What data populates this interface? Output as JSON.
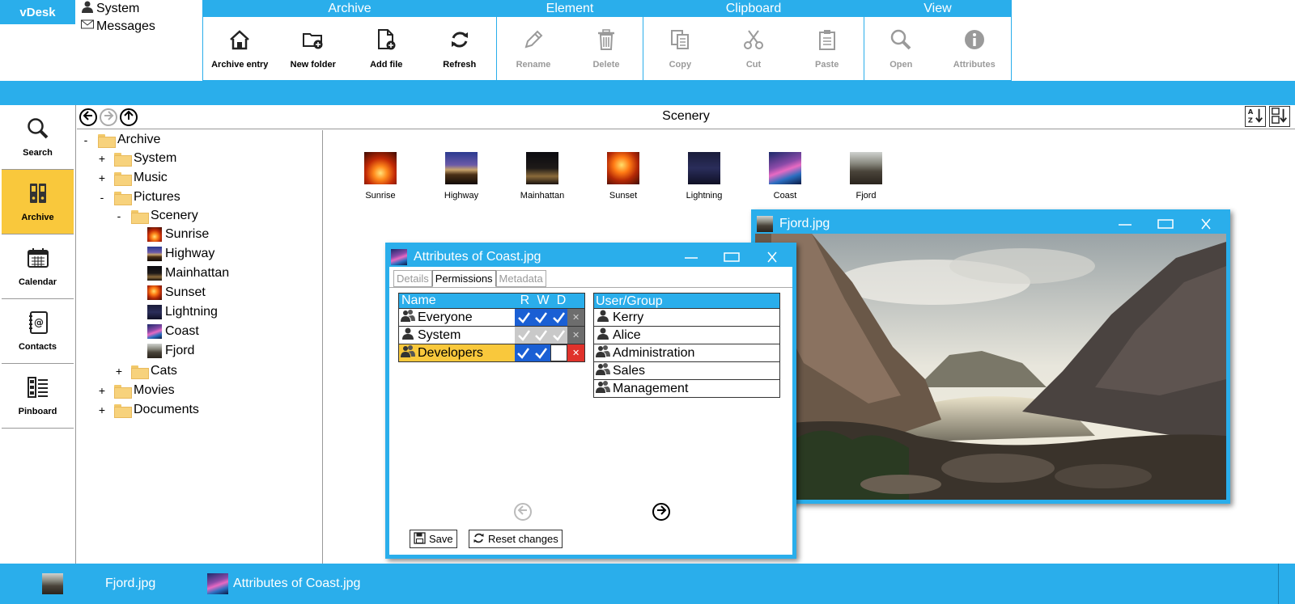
{
  "app": {
    "brand": "vDesk"
  },
  "user_menu": {
    "system": "System",
    "messages": "Messages"
  },
  "ribbon": {
    "archive": {
      "title": "Archive",
      "buttons": [
        "Archive entry",
        "New folder",
        "Add file",
        "Refresh"
      ]
    },
    "element": {
      "title": "Element",
      "buttons": [
        "Rename",
        "Delete"
      ]
    },
    "clipboard": {
      "title": "Clipboard",
      "buttons": [
        "Copy",
        "Cut",
        "Paste"
      ]
    },
    "view": {
      "title": "View",
      "buttons": [
        "Open",
        "Attributes"
      ]
    }
  },
  "nav": [
    "Search",
    "Archive",
    "Calendar",
    "Contacts",
    "Pinboard"
  ],
  "explorer": {
    "title": "Scenery"
  },
  "tree": {
    "archive": "Archive",
    "system": "System",
    "music": "Music",
    "pictures": "Pictures",
    "scenery": "Scenery",
    "files": [
      "Sunrise",
      "Highway",
      "Mainhattan",
      "Sunset",
      "Lightning",
      "Coast",
      "Fjord"
    ],
    "cats": "Cats",
    "movies": "Movies",
    "documents": "Documents"
  },
  "thumbs": [
    "Sunrise",
    "Highway",
    "Mainhattan",
    "Sunset",
    "Lightning",
    "Coast",
    "Fjord"
  ],
  "fjord_window": {
    "title": "Fjord.jpg"
  },
  "attributes_window": {
    "title": "Attributes of Coast.jpg",
    "tabs": [
      "Details",
      "Permissions",
      "Metadata"
    ],
    "perm_headers": {
      "name": "Name",
      "r": "R",
      "w": "W",
      "d": "D"
    },
    "permissions": [
      {
        "name": "Everyone",
        "r": true,
        "w": true,
        "d": true,
        "state": "normal"
      },
      {
        "name": "System",
        "r": true,
        "w": true,
        "d": true,
        "state": "disabled"
      },
      {
        "name": "Developers",
        "r": true,
        "w": true,
        "d": false,
        "state": "selected"
      }
    ],
    "users_header": "User/Group",
    "users": [
      "Kerry",
      "Alice",
      "Administration",
      "Sales",
      "Management"
    ],
    "save": "Save",
    "reset": "Reset changes"
  },
  "taskbar": {
    "items": [
      "Fjord.jpg",
      "Attributes of Coast.jpg"
    ]
  },
  "colors": {
    "accent": "#2aaeeb",
    "highlight": "#f9c83c",
    "check_on": "#1a5fd4",
    "delete": "#e0322b"
  }
}
